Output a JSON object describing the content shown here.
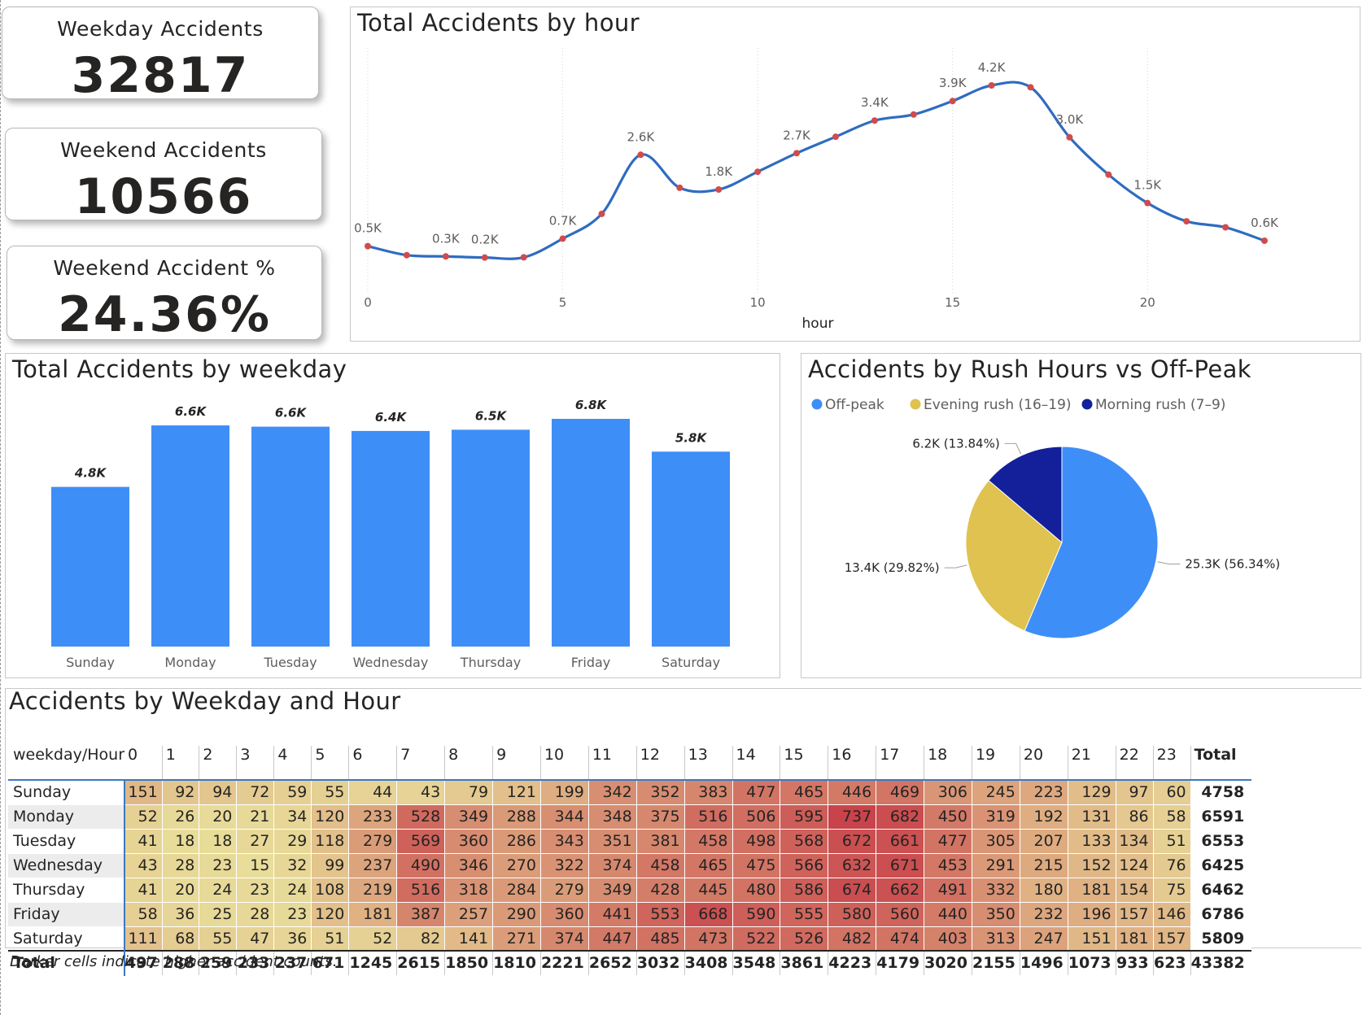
{
  "kpis": [
    {
      "label": "Weekday Accidents",
      "value": "32817"
    },
    {
      "label": "Weekend Accidents",
      "value": "10566"
    },
    {
      "label": "Weekend Accident %",
      "value": "24.36%"
    }
  ],
  "line_panel": {
    "title": "Total Accidents by hour"
  },
  "bar_panel": {
    "title": "Total Accidents by weekday"
  },
  "pie_panel": {
    "title": "Accidents by Rush Hours vs Off-Peak"
  },
  "matrix_panel": {
    "title": "Accidents by Weekday and Hour"
  },
  "footnote": "Darker cells indicate higher accident counts.",
  "colors": {
    "line": "#2f6cc0",
    "marker": "#d24b4b",
    "bar": "#3e8ef7",
    "offpeak": "#3e8ef7",
    "evening": "#dfc24f",
    "morning": "#13209a",
    "heat_low": "#e8dd9a",
    "heat_high": "#c8434b"
  },
  "chart_data": [
    {
      "type": "line",
      "title": "Total Accidents by hour",
      "xlabel": "hour",
      "ylabel": "",
      "x": [
        0,
        1,
        2,
        3,
        4,
        5,
        6,
        7,
        8,
        9,
        10,
        11,
        12,
        13,
        14,
        15,
        16,
        17,
        18,
        19,
        20,
        21,
        22,
        23
      ],
      "values": [
        497,
        288,
        259,
        233,
        237,
        671,
        1245,
        2615,
        1850,
        1810,
        2221,
        2652,
        3032,
        3408,
        3548,
        3861,
        4223,
        4179,
        3020,
        2155,
        1496,
        1073,
        933,
        623
      ],
      "xticks": [
        "0",
        "5",
        "10",
        "15",
        "20"
      ],
      "labels": [
        {
          "x": 0,
          "text": "0.5K"
        },
        {
          "x": 2,
          "text": "0.3K"
        },
        {
          "x": 3,
          "text": "0.2K"
        },
        {
          "x": 5,
          "text": "0.7K"
        },
        {
          "x": 7,
          "text": "2.6K"
        },
        {
          "x": 9,
          "text": "1.8K"
        },
        {
          "x": 11,
          "text": "2.7K"
        },
        {
          "x": 13,
          "text": "3.4K"
        },
        {
          "x": 15,
          "text": "3.9K"
        },
        {
          "x": 16,
          "text": "4.2K"
        },
        {
          "x": 18,
          "text": "3.0K"
        },
        {
          "x": 20,
          "text": "1.5K"
        },
        {
          "x": 23,
          "text": "0.6K"
        }
      ]
    },
    {
      "type": "bar",
      "title": "Total Accidents by weekday",
      "categories": [
        "Sunday",
        "Monday",
        "Tuesday",
        "Wednesday",
        "Thursday",
        "Friday",
        "Saturday"
      ],
      "values": [
        4758,
        6591,
        6553,
        6425,
        6462,
        6786,
        5809
      ],
      "labels": [
        "4.8K",
        "6.6K",
        "6.6K",
        "6.4K",
        "6.5K",
        "6.8K",
        "5.8K"
      ]
    },
    {
      "type": "pie",
      "title": "Accidents by Rush Hours vs Off-Peak",
      "legend": "top-left",
      "series": [
        {
          "name": "Off-peak",
          "value": 25300,
          "label": "25.3K (56.34%)"
        },
        {
          "name": "Evening rush (16–19)",
          "value": 13400,
          "label": "13.4K (29.82%)"
        },
        {
          "name": "Morning rush (7–9)",
          "value": 6200,
          "label": "6.2K (13.84%)"
        }
      ]
    },
    {
      "type": "heatmap",
      "title": "Accidents by Weekday and Hour",
      "corner": "weekday/Hour",
      "columns": [
        "0",
        "1",
        "2",
        "3",
        "4",
        "5",
        "6",
        "7",
        "8",
        "9",
        "10",
        "11",
        "12",
        "13",
        "14",
        "15",
        "16",
        "17",
        "18",
        "19",
        "20",
        "21",
        "22",
        "23"
      ],
      "total_label": "Total",
      "rows": [
        {
          "name": "Sunday",
          "values": [
            151,
            92,
            94,
            72,
            59,
            55,
            44,
            43,
            79,
            121,
            199,
            342,
            352,
            383,
            477,
            465,
            446,
            469,
            306,
            245,
            223,
            129,
            97,
            60
          ],
          "total": 4758
        },
        {
          "name": "Monday",
          "values": [
            52,
            26,
            20,
            21,
            34,
            120,
            233,
            528,
            349,
            288,
            344,
            348,
            375,
            516,
            506,
            595,
            737,
            682,
            450,
            319,
            192,
            131,
            86,
            58
          ],
          "total": 6591
        },
        {
          "name": "Tuesday",
          "values": [
            41,
            18,
            18,
            27,
            29,
            118,
            279,
            569,
            360,
            286,
            343,
            351,
            381,
            458,
            498,
            568,
            672,
            661,
            477,
            305,
            207,
            133,
            134,
            51
          ],
          "total": 6553
        },
        {
          "name": "Wednesday",
          "values": [
            43,
            28,
            23,
            15,
            32,
            99,
            237,
            490,
            346,
            270,
            322,
            374,
            458,
            465,
            475,
            566,
            632,
            671,
            453,
            291,
            215,
            152,
            124,
            76
          ],
          "total": 6425
        },
        {
          "name": "Thursday",
          "values": [
            41,
            20,
            24,
            23,
            24,
            108,
            219,
            516,
            318,
            284,
            279,
            349,
            428,
            445,
            480,
            586,
            674,
            662,
            491,
            332,
            180,
            181,
            154,
            75
          ],
          "total": 6462
        },
        {
          "name": "Friday",
          "values": [
            58,
            36,
            25,
            28,
            23,
            120,
            181,
            387,
            257,
            290,
            360,
            441,
            553,
            668,
            590,
            555,
            580,
            560,
            440,
            350,
            232,
            196,
            157,
            146
          ],
          "total": 6786
        },
        {
          "name": "Saturday",
          "values": [
            111,
            68,
            55,
            47,
            36,
            51,
            52,
            82,
            141,
            271,
            374,
            447,
            485,
            473,
            522,
            526,
            482,
            474,
            403,
            313,
            247,
            151,
            181,
            157
          ],
          "total": 5809
        }
      ],
      "totals_row": {
        "name": "Total",
        "values": [
          497,
          288,
          259,
          233,
          237,
          671,
          1245,
          2615,
          1850,
          1810,
          2221,
          2652,
          3032,
          3408,
          3548,
          3861,
          4223,
          4179,
          3020,
          2155,
          1496,
          1073,
          933,
          623
        ],
        "total": 43382
      }
    }
  ]
}
